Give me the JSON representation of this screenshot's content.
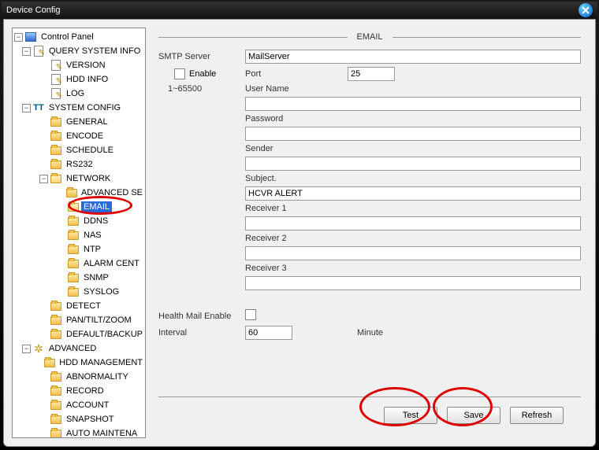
{
  "window": {
    "title": "Device Config"
  },
  "tree": {
    "root": "Control Panel",
    "query": "QUERY SYSTEM INFO",
    "version": "VERSION",
    "hddinfo": "HDD INFO",
    "log": "LOG",
    "system": "SYSTEM CONFIG",
    "general": "GENERAL",
    "encode": "ENCODE",
    "schedule": "SCHEDULE",
    "rs232": "RS232",
    "network": "NETWORK",
    "advset": "ADVANCED SE",
    "email": "EMAIL",
    "ddns": "DDNS",
    "nas": "NAS",
    "ntp": "NTP",
    "alarmc": "ALARM CENT",
    "snmp": "SNMP",
    "syslog": "SYSLOG",
    "detect": "DETECT",
    "ptz": "PAN/TILT/ZOOM",
    "defbak": "DEFAULT/BACKUP",
    "advanced": "ADVANCED",
    "hddm": "HDD MANAGEMENT",
    "abn": "ABNORMALITY",
    "record": "RECORD",
    "account": "ACCOUNT",
    "snapshot": "SNAPSHOT",
    "automaint": "AUTO MAINTENA"
  },
  "section": {
    "title": "EMAIL"
  },
  "form": {
    "smtp_label": "SMTP Server",
    "smtp_value": "MailServer",
    "port_label": "Port",
    "port_value": "25",
    "port_hint": "1~65500",
    "enable_label": "Enable",
    "user_label": "User Name",
    "user_value": "",
    "pass_label": "Password",
    "pass_value": "",
    "sender_label": "Sender",
    "sender_value": "",
    "subject_label": "Subject.",
    "subject_value": "HCVR ALERT",
    "recv1_label": "Receiver 1",
    "recv1_value": "",
    "recv2_label": "Receiver 2",
    "recv2_value": "",
    "recv3_label": "Receiver 3",
    "recv3_value": "",
    "health_label": "Health Mail Enable",
    "interval_label": "Interval",
    "interval_value": "60",
    "interval_unit": "Minute"
  },
  "buttons": {
    "test": "Test",
    "save": "Save",
    "refresh": "Refresh"
  }
}
